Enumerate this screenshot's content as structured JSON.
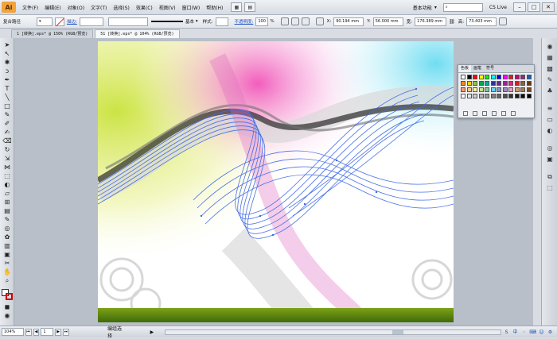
{
  "app": {
    "logo_text": "Ai",
    "menu": [
      "文件(F)",
      "编辑(E)",
      "对象(O)",
      "文字(T)",
      "选择(S)",
      "效果(C)",
      "视图(V)",
      "窗口(W)",
      "帮助(H)"
    ],
    "workspace": "基本功能",
    "search_placeholder": "",
    "cs_live": "CS Live"
  },
  "controlbar": {
    "selection_label": "复合路径",
    "stroke_link": "描边:",
    "stroke_profile": "基本",
    "style_label": "样式:",
    "opacity_link": "不透明度:",
    "opacity_value": "100",
    "opacity_unit": "%",
    "x_label": "X:",
    "x_value": "90.194 mm",
    "y_label": "Y:",
    "y_value": "56.000 mm",
    "w_label": "宽:",
    "w_value": "176.389 mm",
    "h_label": "高:",
    "h_value": "73.403 mm"
  },
  "tabs": [
    {
      "label": "1 [转换].eps* @ 150% (RGB/预览)"
    },
    {
      "label": "51 [转换].eps* @ 104% (RGB/预览)"
    }
  ],
  "status": {
    "zoom": "104%",
    "page": "1",
    "mode": "编组选择"
  },
  "swatch_panel": {
    "tabs": [
      "色板",
      "画笔",
      "符号"
    ],
    "colors": [
      "#ffffff",
      "#000000",
      "#ff0000",
      "#ffff00",
      "#00ff00",
      "#00ffff",
      "#0000ff",
      "#ff00ff",
      "#e31c1c",
      "#c7007d",
      "#8e2a8e",
      "#1a5fb4",
      "#f08a24",
      "#f5d300",
      "#8dc63f",
      "#00a651",
      "#00a99d",
      "#2e3192",
      "#662d91",
      "#92278f",
      "#ed1e79",
      "#c1272d",
      "#8c6239",
      "#603813",
      "#f7977a",
      "#fdc68a",
      "#fff79a",
      "#c4df9b",
      "#82ca9c",
      "#6dcff6",
      "#8393ca",
      "#a187be",
      "#f49ac1",
      "#c69c6d",
      "#a67c52",
      "#754c24",
      "#ffffff",
      "#e6e6e6",
      "#cccccc",
      "#b3b3b3",
      "#999999",
      "#808080",
      "#666666",
      "#4d4d4d",
      "#333333",
      "#1a1a1a",
      "#0d0d0d",
      "#000000"
    ]
  }
}
